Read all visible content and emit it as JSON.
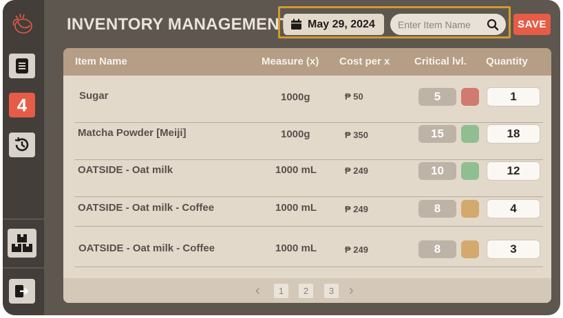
{
  "header": {
    "title": "INVENTORY MANAGEMENT",
    "date": "May 29, 2024",
    "search_placeholder": "Enter Item Name",
    "save_label": "SAVE"
  },
  "sidebar": {
    "active_badge": "4",
    "items": [
      "logo",
      "document-icon",
      "alerts-count",
      "history-icon",
      "inventory-icon",
      "logout-icon"
    ]
  },
  "table": {
    "columns": [
      "Item Name",
      "Measure (x)",
      "Cost per x",
      "Critical lvl.",
      "Quantity"
    ],
    "rows": [
      {
        "name": "Sugar",
        "measure": "1000g",
        "cost": "₱ 50",
        "critical": "5",
        "status": "low",
        "quantity": "1"
      },
      {
        "name": "Matcha Powder [Meiji]",
        "measure": "1000g",
        "cost": "₱ 350",
        "critical": "15",
        "status": "ok",
        "quantity": "18"
      },
      {
        "name": "OATSIDE - Oat milk",
        "measure": "1000 mL",
        "cost": "₱ 249",
        "critical": "10",
        "status": "ok",
        "quantity": "12"
      },
      {
        "name": "OATSIDE - Oat milk - Coffee",
        "measure": "1000 mL",
        "cost": "₱ 249",
        "critical": "8",
        "status": "warning",
        "quantity": "4"
      },
      {
        "name": "OATSIDE - Oat milk - Coffee",
        "measure": "1000 mL",
        "cost": "₱ 249",
        "critical": "8",
        "status": "warning",
        "quantity": "3"
      }
    ]
  },
  "pagination": {
    "pages": [
      "1",
      "2",
      "3"
    ],
    "prev": "‹",
    "next": "›"
  },
  "colors": {
    "low": "#d17a70",
    "ok": "#8fbf90",
    "warning": "#d4a96d",
    "accent": "#e65c46",
    "highlight": "#d39a2e"
  }
}
